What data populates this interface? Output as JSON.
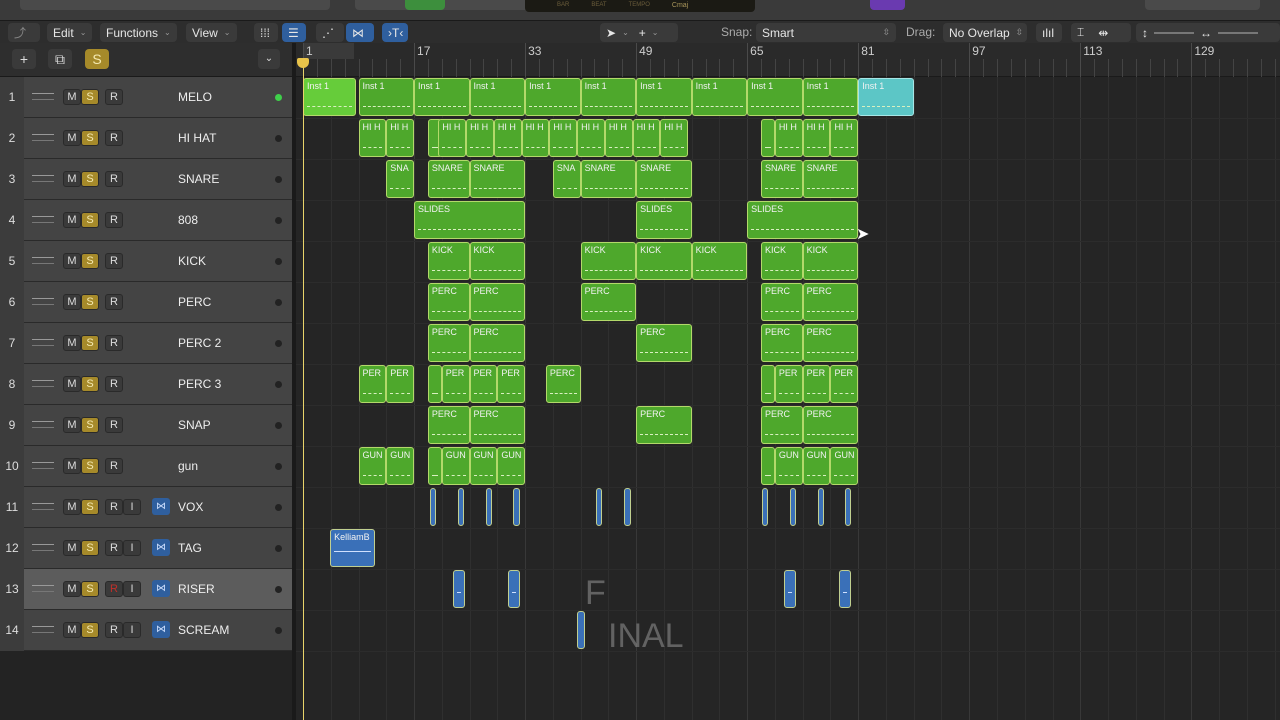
{
  "lcd": {
    "labels": [
      "BAR",
      "BEAT",
      "TEMPO"
    ],
    "key": "Cmaj"
  },
  "toolbar": {
    "edit": "Edit",
    "functions": "Functions",
    "view": "View",
    "snap_label": "Snap:",
    "snap_value": "Smart",
    "drag_label": "Drag:",
    "drag_value": "No Overlap"
  },
  "list_header": {
    "add": "+",
    "solo": "S"
  },
  "ruler": {
    "bars": [
      "1",
      "17",
      "33",
      "49",
      "65",
      "81",
      "97",
      "113",
      "129"
    ]
  },
  "tracks": [
    {
      "num": "1",
      "name": "MELO",
      "audio": false,
      "dot": "on"
    },
    {
      "num": "2",
      "name": "HI HAT",
      "audio": false
    },
    {
      "num": "3",
      "name": "SNARE",
      "audio": false
    },
    {
      "num": "4",
      "name": "808",
      "audio": false
    },
    {
      "num": "5",
      "name": "KICK",
      "audio": false
    },
    {
      "num": "6",
      "name": "PERC",
      "audio": false
    },
    {
      "num": "7",
      "name": "PERC 2",
      "audio": false
    },
    {
      "num": "8",
      "name": "PERC 3",
      "audio": false
    },
    {
      "num": "9",
      "name": "SNAP",
      "audio": false
    },
    {
      "num": "10",
      "name": "gun",
      "audio": false
    },
    {
      "num": "11",
      "name": "VOX",
      "audio": true
    },
    {
      "num": "12",
      "name": "TAG",
      "audio": true
    },
    {
      "num": "13",
      "name": "RISER",
      "audio": true,
      "selected": true,
      "record_armed_red": true
    },
    {
      "num": "14",
      "name": "SCREAM",
      "audio": true
    }
  ],
  "buttons": {
    "m": "M",
    "s": "S",
    "r": "R",
    "i": "I"
  },
  "regions": [
    [
      {
        "s": 1,
        "l": 7.7,
        "t": "Inst 1",
        "c": "bright"
      },
      {
        "s": 9,
        "l": 8,
        "t": "Inst 1"
      },
      {
        "s": 17,
        "l": 8,
        "t": "Inst 1"
      },
      {
        "s": 25,
        "l": 8,
        "t": "Inst 1"
      },
      {
        "s": 33,
        "l": 8,
        "t": "Inst 1"
      },
      {
        "s": 41,
        "l": 8,
        "t": "Inst 1"
      },
      {
        "s": 49,
        "l": 8,
        "t": "Inst 1"
      },
      {
        "s": 57,
        "l": 8,
        "t": "Inst 1"
      },
      {
        "s": 65,
        "l": 8,
        "t": "Inst 1"
      },
      {
        "s": 73,
        "l": 8,
        "t": "Inst 1"
      },
      {
        "s": 81,
        "l": 8,
        "t": "Inst 1",
        "c": "cyan"
      }
    ],
    [
      {
        "s": 9,
        "l": 4,
        "t": "HI H"
      },
      {
        "s": 13,
        "l": 4,
        "t": "HI H"
      },
      {
        "s": 19,
        "l": 2,
        "t": ""
      },
      {
        "s": 20.5,
        "l": 4,
        "t": "HI H"
      },
      {
        "s": 24.5,
        "l": 4,
        "t": "HI H"
      },
      {
        "s": 28.5,
        "l": 4,
        "t": "HI H"
      },
      {
        "s": 32.5,
        "l": 4,
        "t": "HI H"
      },
      {
        "s": 36.5,
        "l": 4,
        "t": "HI H"
      },
      {
        "s": 40.5,
        "l": 4,
        "t": "HI H"
      },
      {
        "s": 44.5,
        "l": 4,
        "t": "HI H"
      },
      {
        "s": 48.5,
        "l": 4,
        "t": "HI H"
      },
      {
        "s": 52.5,
        "l": 4,
        "t": "HI H"
      },
      {
        "s": 67,
        "l": 2,
        "t": ""
      },
      {
        "s": 69,
        "l": 4,
        "t": "HI H"
      },
      {
        "s": 73,
        "l": 4,
        "t": "HI H"
      },
      {
        "s": 77,
        "l": 4,
        "t": "HI H"
      }
    ],
    [
      {
        "s": 13,
        "l": 4,
        "t": "SNA"
      },
      {
        "s": 19,
        "l": 6,
        "t": "SNARE"
      },
      {
        "s": 25,
        "l": 8,
        "t": "SNARE"
      },
      {
        "s": 37,
        "l": 4,
        "t": "SNA"
      },
      {
        "s": 41,
        "l": 8,
        "t": "SNARE"
      },
      {
        "s": 49,
        "l": 8,
        "t": "SNARE"
      },
      {
        "s": 67,
        "l": 6,
        "t": "SNARE"
      },
      {
        "s": 73,
        "l": 8,
        "t": "SNARE"
      }
    ],
    [
      {
        "s": 17,
        "l": 16,
        "t": "SLIDES"
      },
      {
        "s": 49,
        "l": 8,
        "t": "SLIDES"
      },
      {
        "s": 65,
        "l": 16,
        "t": "SLIDES"
      }
    ],
    [
      {
        "s": 19,
        "l": 6,
        "t": "KICK"
      },
      {
        "s": 25,
        "l": 8,
        "t": "KICK"
      },
      {
        "s": 41,
        "l": 8,
        "t": "KICK"
      },
      {
        "s": 49,
        "l": 8,
        "t": "KICK"
      },
      {
        "s": 57,
        "l": 8,
        "t": "KICK"
      },
      {
        "s": 67,
        "l": 6,
        "t": "KICK"
      },
      {
        "s": 73,
        "l": 8,
        "t": "KICK"
      }
    ],
    [
      {
        "s": 19,
        "l": 6,
        "t": "PERC"
      },
      {
        "s": 25,
        "l": 8,
        "t": "PERC"
      },
      {
        "s": 41,
        "l": 8,
        "t": "PERC"
      },
      {
        "s": 67,
        "l": 6,
        "t": "PERC"
      },
      {
        "s": 73,
        "l": 8,
        "t": "PERC"
      }
    ],
    [
      {
        "s": 19,
        "l": 6,
        "t": "PERC"
      },
      {
        "s": 25,
        "l": 8,
        "t": "PERC"
      },
      {
        "s": 49,
        "l": 8,
        "t": "PERC"
      },
      {
        "s": 67,
        "l": 6,
        "t": "PERC"
      },
      {
        "s": 73,
        "l": 8,
        "t": "PERC"
      }
    ],
    [
      {
        "s": 9,
        "l": 4,
        "t": "PER"
      },
      {
        "s": 13,
        "l": 4,
        "t": "PER"
      },
      {
        "s": 19,
        "l": 2,
        "t": ""
      },
      {
        "s": 21,
        "l": 4,
        "t": "PER"
      },
      {
        "s": 25,
        "l": 4,
        "t": "PER"
      },
      {
        "s": 29,
        "l": 4,
        "t": "PER"
      },
      {
        "s": 36,
        "l": 5,
        "t": "PERC"
      },
      {
        "s": 67,
        "l": 2,
        "t": ""
      },
      {
        "s": 69,
        "l": 4,
        "t": "PER"
      },
      {
        "s": 73,
        "l": 4,
        "t": "PER"
      },
      {
        "s": 77,
        "l": 4,
        "t": "PER"
      }
    ],
    [
      {
        "s": 19,
        "l": 6,
        "t": "PERC"
      },
      {
        "s": 25,
        "l": 8,
        "t": "PERC"
      },
      {
        "s": 49,
        "l": 8,
        "t": "PERC"
      },
      {
        "s": 67,
        "l": 6,
        "t": "PERC"
      },
      {
        "s": 73,
        "l": 8,
        "t": "PERC"
      }
    ],
    [
      {
        "s": 9,
        "l": 4,
        "t": "GUN"
      },
      {
        "s": 13,
        "l": 4,
        "t": "GUN"
      },
      {
        "s": 19,
        "l": 2,
        "t": ""
      },
      {
        "s": 21,
        "l": 4,
        "t": "GUN"
      },
      {
        "s": 25,
        "l": 4,
        "t": "GUN"
      },
      {
        "s": 29,
        "l": 4,
        "t": "GUN"
      },
      {
        "s": 67,
        "l": 2,
        "t": ""
      },
      {
        "s": 69,
        "l": 4,
        "t": "GUN"
      },
      {
        "s": 73,
        "l": 4,
        "t": "GUN"
      },
      {
        "s": 77,
        "l": 4,
        "t": "GUN"
      }
    ],
    [
      {
        "s": 19.3,
        "l": 0.9,
        "t": "",
        "c": "blue"
      },
      {
        "s": 23.3,
        "l": 0.9,
        "t": "",
        "c": "blue"
      },
      {
        "s": 27.3,
        "l": 0.9,
        "t": "",
        "c": "blue"
      },
      {
        "s": 31.3,
        "l": 0.9,
        "t": "",
        "c": "blue"
      },
      {
        "s": 43.2,
        "l": 0.9,
        "t": "",
        "c": "blue"
      },
      {
        "s": 47.3,
        "l": 0.9,
        "t": "",
        "c": "blue"
      },
      {
        "s": 67.1,
        "l": 0.9,
        "t": "",
        "c": "blue"
      },
      {
        "s": 71.2,
        "l": 0.9,
        "t": "",
        "c": "blue"
      },
      {
        "s": 75.2,
        "l": 0.9,
        "t": "",
        "c": "blue"
      },
      {
        "s": 79.1,
        "l": 0.9,
        "t": "",
        "c": "blue"
      }
    ],
    [
      {
        "s": 4.9,
        "l": 6.5,
        "t": "KelliamB",
        "c": "blue"
      }
    ],
    [
      {
        "s": 22.6,
        "l": 1.8,
        "t": "",
        "c": "blue"
      },
      {
        "s": 30.5,
        "l": 1.8,
        "t": "",
        "c": "blue"
      },
      {
        "s": 70.3,
        "l": 1.8,
        "t": "",
        "c": "blue"
      },
      {
        "s": 78.2,
        "l": 1.8,
        "t": "",
        "c": "blue"
      }
    ],
    [
      {
        "s": 40.5,
        "l": 1.1,
        "t": "",
        "c": "blue"
      }
    ]
  ],
  "watermark": {
    "line1": "F",
    "line2": "INAL"
  },
  "colors": {
    "region_green": "#4ea82c",
    "region_cyan": "#5cc6c6",
    "audio_blue": "#3a70b8",
    "solo_yellow": "#a68a2a",
    "playhead": "#e8d36a"
  }
}
